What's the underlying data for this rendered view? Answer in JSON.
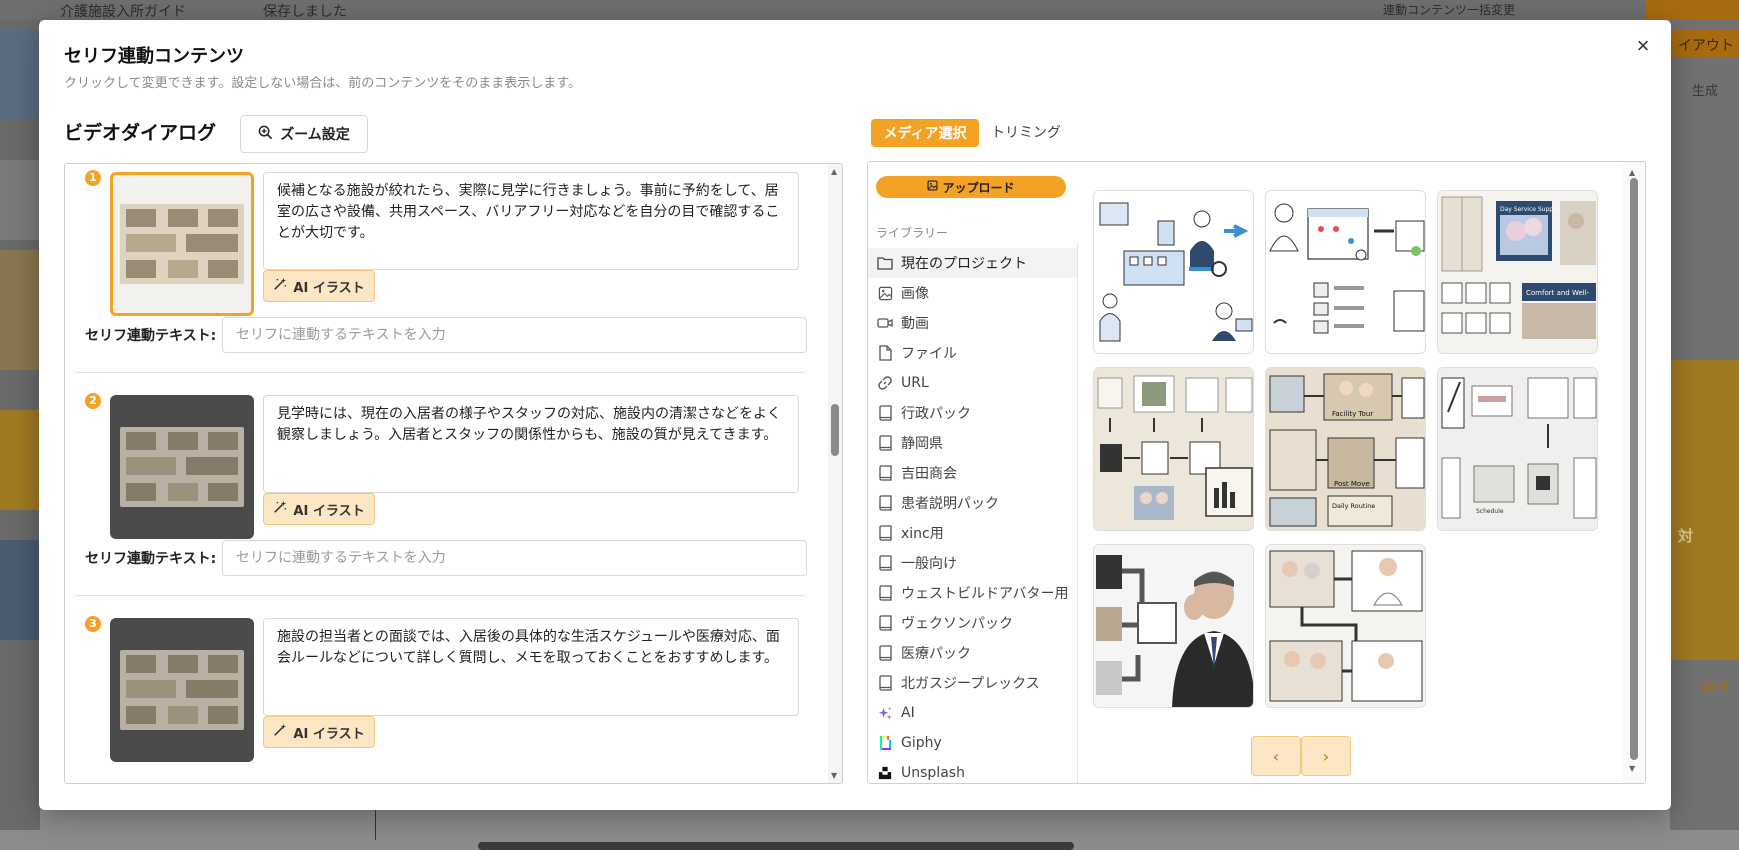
{
  "background": {
    "topbar_left": "介護施設入所ガイド",
    "topbar_saved": "保存しました",
    "topbar_right": "連動コンテンツ一括変更",
    "right_pill": "イアウト",
    "right_gen": "生成",
    "right_orange_text": "対",
    "right_ratio": "16:9"
  },
  "modal": {
    "title": "セリフ連動コンテンツ",
    "subtitle": "クリックして変更できます。設定しない場合は、前のコンテンツをそのまま表示します。",
    "close_label": "×",
    "section_title": "ビデオダイアログ",
    "zoom_button": "ズーム設定"
  },
  "items": [
    {
      "badge": "1",
      "text": "候補となる施設が絞れたら、実際に見学に行きましょう。事前に予約をして、居室の広さや設備、共用スペース、バリアフリー対応などを自分の目で確認することが大切です。",
      "ai_button": "AI イラスト",
      "label": "セリフ連動テキスト:",
      "placeholder": "セリフに連動するテキストを入力",
      "selected": true
    },
    {
      "badge": "2",
      "text": "見学時には、現在の入居者の様子やスタッフの対応、施設内の清潔さなどをよく観察しましょう。入居者とスタッフの関係性からも、施設の質が見えてきます。",
      "ai_button": "AI イラスト",
      "label": "セリフ連動テキスト:",
      "placeholder": "セリフに連動するテキストを入力",
      "selected": false
    },
    {
      "badge": "3",
      "text": "施設の担当者との面談では、入居後の具体的な生活スケジュールや医療対応、面会ルールなどについて詳しく質問し、メモを取っておくことをおすすめします。",
      "ai_button": "AI イラスト",
      "selected": false
    }
  ],
  "media": {
    "tab_media": "メディア選択",
    "tab_trim": "トリミング",
    "upload": "アップロード",
    "library_label": "ライブラリー",
    "library": [
      {
        "label": "現在のプロジェクト",
        "icon": "folder-icon",
        "active": true
      },
      {
        "label": "画像",
        "icon": "image-icon",
        "active": false
      },
      {
        "label": "動画",
        "icon": "video-icon",
        "active": false
      },
      {
        "label": "ファイル",
        "icon": "file-icon",
        "active": false
      },
      {
        "label": "URL",
        "icon": "link-icon",
        "active": false
      },
      {
        "label": "行政パック",
        "icon": "book-icon",
        "active": false
      },
      {
        "label": "静岡県",
        "icon": "book-icon",
        "active": false
      },
      {
        "label": "吉田商会",
        "icon": "book-icon",
        "active": false
      },
      {
        "label": "患者説明パック",
        "icon": "book-icon",
        "active": false
      },
      {
        "label": "xinc用",
        "icon": "book-icon",
        "active": false
      },
      {
        "label": "一般向け",
        "icon": "book-icon",
        "active": false
      },
      {
        "label": "ウェストビルドアバター用",
        "icon": "book-icon",
        "active": false
      },
      {
        "label": "ヴェクソンパック",
        "icon": "book-icon",
        "active": false
      },
      {
        "label": "医療パック",
        "icon": "book-icon",
        "active": false
      },
      {
        "label": "北ガスジープレックス",
        "icon": "book-icon",
        "active": false
      },
      {
        "label": "AI",
        "icon": "ai-sparkle-icon",
        "active": false
      },
      {
        "label": "Giphy",
        "icon": "giphy-icon",
        "active": false
      },
      {
        "label": "Unsplash",
        "icon": "unsplash-icon",
        "active": false
      }
    ],
    "grid_labels": {
      "img3_a": "Day Service Support",
      "img3_b": "Comfort and Well-",
      "img5_a": "Facility Tour",
      "img5_b": "Post Move",
      "img5_c": "Daily Routine",
      "img6_a": "Schedule"
    },
    "prev": "‹",
    "next": "›"
  },
  "colors": {
    "accent": "#f3a225",
    "accent_light": "#fde6c4"
  }
}
